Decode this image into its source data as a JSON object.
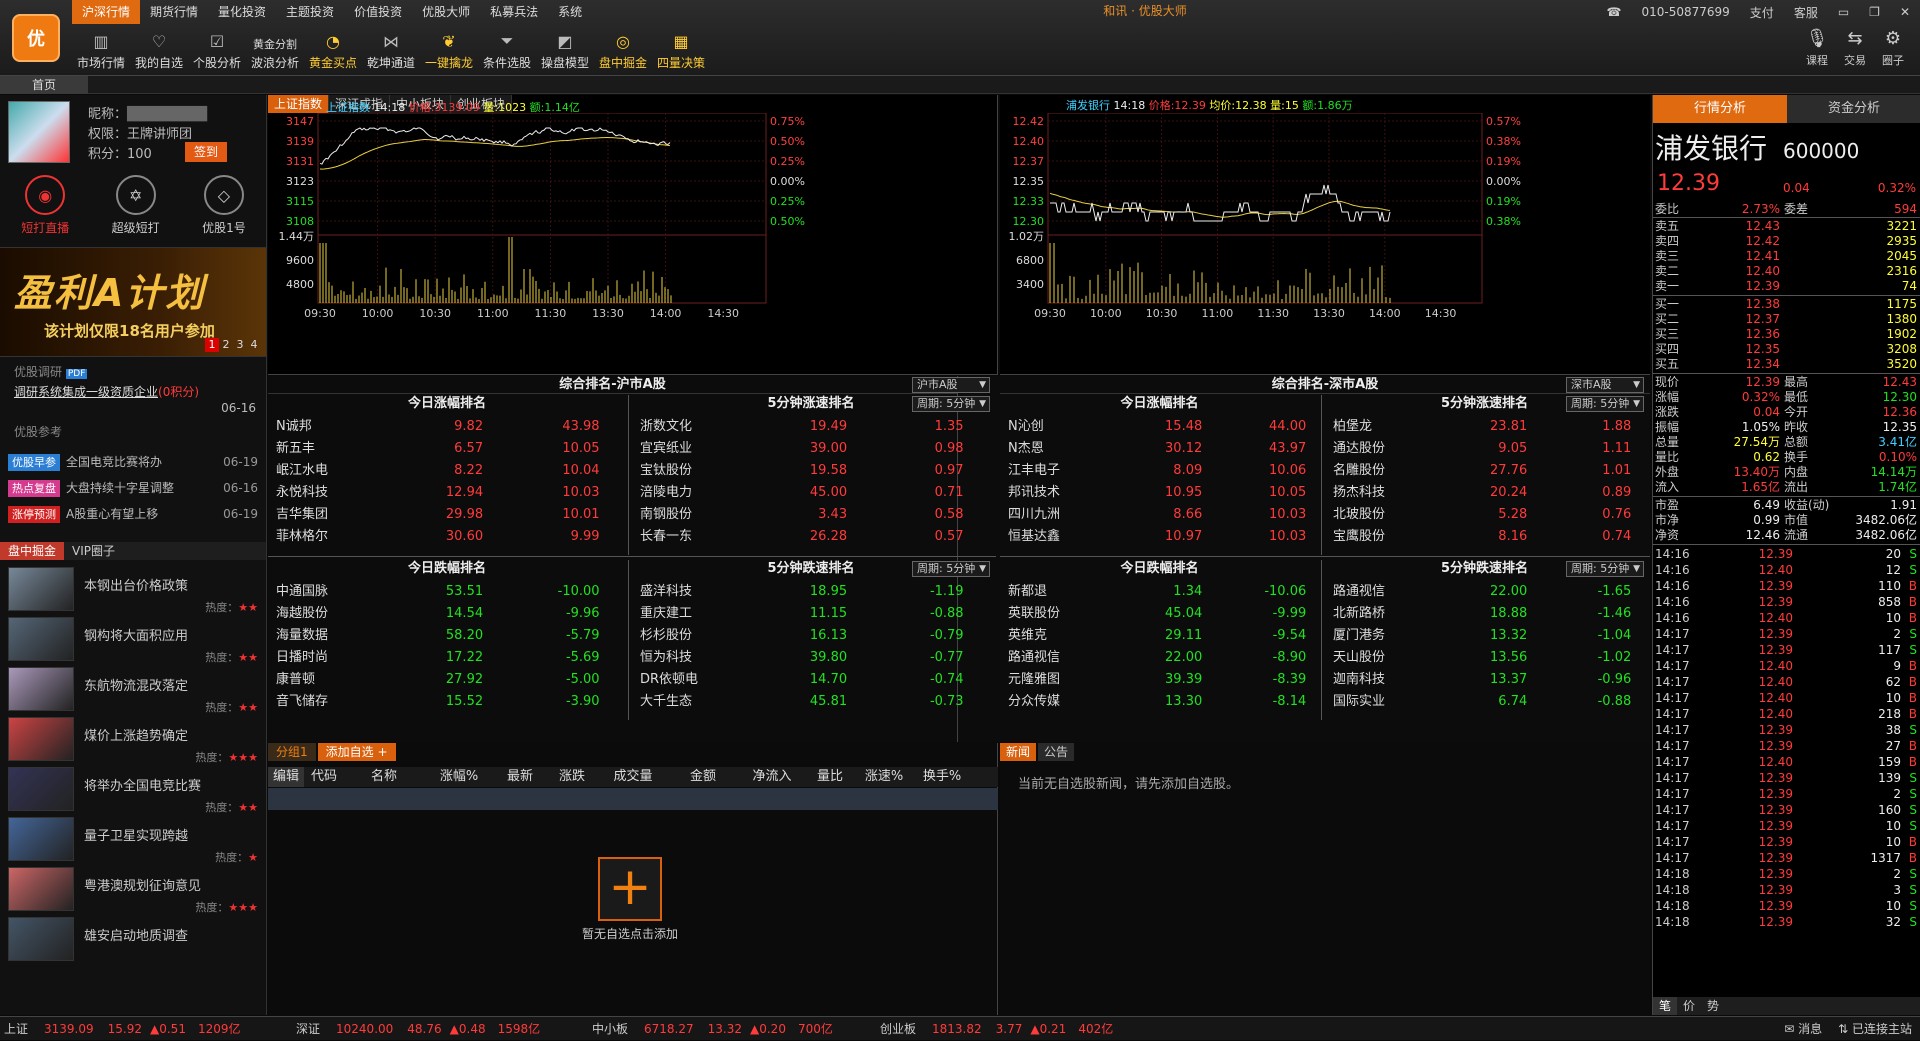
{
  "app": {
    "title": "和讯 · 优股大师",
    "phone": "010-50877699",
    "pay": "支付",
    "support": "客服"
  },
  "topmenu": [
    "沪深行情",
    "期货行情",
    "量化投资",
    "主题投资",
    "价值投资",
    "优股大师",
    "私募兵法",
    "系统"
  ],
  "toolbar": [
    {
      "label": "市场行情",
      "icon": "chart-icon"
    },
    {
      "label": "我的自选",
      "icon": "heart-icon"
    },
    {
      "label": "个股分析",
      "icon": "check-icon"
    },
    {
      "label": "波浪分析",
      "icon": "wave-icon",
      "top": "黄金分割"
    },
    {
      "label": "黄金买点",
      "icon": "radar-icon",
      "gold": true
    },
    {
      "label": "乾坤通道",
      "icon": "nodes-icon"
    },
    {
      "label": "一键擒龙",
      "icon": "dragon-icon",
      "gold": true
    },
    {
      "label": "条件选股",
      "icon": "funnel-icon"
    },
    {
      "label": "操盘模型",
      "icon": "model-icon"
    },
    {
      "label": "盘中掘金",
      "icon": "coin-icon",
      "gold": true
    },
    {
      "label": "四量决策",
      "icon": "abacus-icon",
      "gold": true
    }
  ],
  "rightbtns": [
    {
      "label": "课程",
      "icon": "mic-icon"
    },
    {
      "label": "交易",
      "icon": "trade-icon"
    },
    {
      "label": "圈子",
      "icon": "circle-icon"
    }
  ],
  "hometab": "首页",
  "user": {
    "nick_label": "昵称：",
    "nick": "████████",
    "rights_label": "权限：",
    "rights": "王牌讲师团",
    "points_label": "积分：",
    "points": "100",
    "sign": "签到"
  },
  "sideicons": [
    {
      "label": "短打直播",
      "icon": "live-icon",
      "active": true
    },
    {
      "label": "超级短打",
      "icon": "star-icon"
    },
    {
      "label": "优股1号",
      "icon": "gem-icon"
    }
  ],
  "banner": {
    "big": "盈利A计划",
    "small": "该计划仅限18名用户参加",
    "pages": [
      "1",
      "2",
      "3",
      "4"
    ]
  },
  "research": {
    "head": "优股调研",
    "badge": "PDF",
    "item": "调研系统集成一级资质企业",
    "points": "(0积分)",
    "date": "06-16"
  },
  "reference": {
    "head": "优股参考",
    "items": [
      {
        "tag": "优股早参",
        "color": "#2a7fd4",
        "text": "全国电竞比赛将办",
        "date": "06-19"
      },
      {
        "tag": "热点复盘",
        "color": "#d43b8f",
        "text": "大盘持续十字星调整",
        "date": "06-16"
      },
      {
        "tag": "涨停预测",
        "color": "#d02020",
        "text": "A股重心有望上移",
        "date": "06-19"
      }
    ]
  },
  "sidetabs": [
    "盘中掘金",
    "VIP圈子"
  ],
  "feed": {
    "heat_label": "热度：",
    "items": [
      {
        "title": "本钢出台价格政策",
        "stars": "★★",
        "c": "#789"
      },
      {
        "title": "钢构将大面积应用",
        "stars": "★★",
        "c": "#567"
      },
      {
        "title": "东航物流混改落定",
        "stars": "★★",
        "c": "#a9b"
      },
      {
        "title": "煤价上涨趋势确定",
        "stars": "★★★",
        "c": "#c44"
      },
      {
        "title": "将举办全国电竞比赛",
        "stars": "★★",
        "c": "#335"
      },
      {
        "title": "量子卫星实现跨越",
        "stars": "★",
        "c": "#469"
      },
      {
        "title": "粤港澳规划征询意见",
        "stars": "★★★",
        "c": "#c66"
      },
      {
        "title": "雄安启动地质调查",
        "stars": "",
        "c": "#456"
      }
    ]
  },
  "idxtabs": [
    "上证指数",
    "深证成指",
    "中小板块",
    "创业板块"
  ],
  "chartL": {
    "name": "上证指数",
    "time": "14:18",
    "price_label": "价格:",
    "price": "3139.09",
    "vol_label": "量:",
    "vol": "1023",
    "amt_label": "额:",
    "amt": "1.14亿",
    "y_labels": [
      "3147",
      "3139",
      "3131",
      "3123",
      "3115",
      "3108"
    ],
    "pct_labels": [
      "0.75%",
      "0.50%",
      "0.25%",
      "0.00%",
      "0.25%",
      "0.50%"
    ],
    "vol_labels": [
      "1.44万",
      "9600",
      "4800"
    ],
    "x_labels": [
      "09:30",
      "10:00",
      "10:30",
      "11:00",
      "11:30",
      "13:30",
      "14:00",
      "14:30"
    ]
  },
  "chartR": {
    "name": "浦发银行",
    "time": "14:18",
    "price_label": "价格:",
    "price": "12.39",
    "avg_label": "均价:",
    "avg": "12.38",
    "vol_label": "量:",
    "vol": "15",
    "amt_label": "额:",
    "amt": "1.86万",
    "y_labels": [
      "12.42",
      "12.40",
      "12.37",
      "12.35",
      "12.33",
      "12.30"
    ],
    "pct_labels": [
      "0.57%",
      "0.38%",
      "0.19%",
      "0.00%",
      "0.19%",
      "0.38%"
    ],
    "vol_labels": [
      "1.02万",
      "6800",
      "3400"
    ],
    "x_labels": [
      "09:30",
      "10:00",
      "10:30",
      "11:00",
      "11:30",
      "13:30",
      "14:00",
      "14:30"
    ]
  },
  "rankL": {
    "title": "综合排名-沪市A股",
    "select": "沪市A股",
    "period": "周期: 5分钟",
    "up_title": "今日涨幅排名",
    "fast_up_title": "5分钟涨速排名",
    "down_title": "今日跌幅排名",
    "fast_down_title": "5分钟跌速排名",
    "up": [
      [
        "N诚邦",
        "9.82",
        "43.98"
      ],
      [
        "新五丰",
        "6.57",
        "10.05"
      ],
      [
        "岷江水电",
        "8.22",
        "10.04"
      ],
      [
        "永悦科技",
        "12.94",
        "10.03"
      ],
      [
        "吉华集团",
        "29.98",
        "10.01"
      ],
      [
        "菲林格尔",
        "30.60",
        "9.99"
      ]
    ],
    "fast_up": [
      [
        "浙数文化",
        "19.49",
        "1.35"
      ],
      [
        "宜宾纸业",
        "39.00",
        "0.98"
      ],
      [
        "宝钛股份",
        "19.58",
        "0.97"
      ],
      [
        "涪陵电力",
        "45.00",
        "0.71"
      ],
      [
        "南钢股份",
        "3.43",
        "0.58"
      ],
      [
        "长春一东",
        "26.28",
        "0.57"
      ]
    ],
    "down": [
      [
        "中通国脉",
        "53.51",
        "-10.00"
      ],
      [
        "海越股份",
        "14.54",
        "-9.96"
      ],
      [
        "海量数据",
        "58.20",
        "-5.79"
      ],
      [
        "日播时尚",
        "17.22",
        "-5.69"
      ],
      [
        "康普顿",
        "27.92",
        "-5.00"
      ],
      [
        "音飞储存",
        "15.52",
        "-3.90"
      ]
    ],
    "fast_down": [
      [
        "盛洋科技",
        "18.95",
        "-1.19"
      ],
      [
        "重庆建工",
        "11.15",
        "-0.88"
      ],
      [
        "杉杉股份",
        "16.13",
        "-0.79"
      ],
      [
        "恒为科技",
        "39.80",
        "-0.77"
      ],
      [
        "DR依顿电",
        "14.70",
        "-0.74"
      ],
      [
        "大千生态",
        "45.81",
        "-0.73"
      ]
    ]
  },
  "rankR": {
    "title": "综合排名-深市A股",
    "select": "深市A股",
    "period": "周期: 5分钟",
    "up_title": "今日涨幅排名",
    "fast_up_title": "5分钟涨速排名",
    "down_title": "今日跌幅排名",
    "fast_down_title": "5分钟跌速排名",
    "up": [
      [
        "N沁创",
        "15.48",
        "44.00"
      ],
      [
        "N杰恩",
        "30.12",
        "43.97"
      ],
      [
        "江丰电子",
        "8.09",
        "10.06"
      ],
      [
        "邦讯技术",
        "10.95",
        "10.05"
      ],
      [
        "四川九洲",
        "8.66",
        "10.03"
      ],
      [
        "恒基达鑫",
        "10.97",
        "10.03"
      ]
    ],
    "fast_up": [
      [
        "柏堡龙",
        "23.81",
        "1.88"
      ],
      [
        "通达股份",
        "9.05",
        "1.11"
      ],
      [
        "名雕股份",
        "27.76",
        "1.01"
      ],
      [
        "扬杰科技",
        "20.24",
        "0.89"
      ],
      [
        "北玻股份",
        "5.28",
        "0.76"
      ],
      [
        "宝鹰股份",
        "8.16",
        "0.74"
      ]
    ],
    "down": [
      [
        "新都退",
        "1.34",
        "-10.06"
      ],
      [
        "英联股份",
        "45.04",
        "-9.99"
      ],
      [
        "英维克",
        "29.11",
        "-9.54"
      ],
      [
        "路通视信",
        "22.00",
        "-8.90"
      ],
      [
        "元隆雅图",
        "39.39",
        "-8.39"
      ],
      [
        "分众传媒",
        "13.30",
        "-8.14"
      ]
    ],
    "fast_down": [
      [
        "路通视信",
        "22.00",
        "-1.65"
      ],
      [
        "北新路桥",
        "18.88",
        "-1.46"
      ],
      [
        "厦门港务",
        "13.32",
        "-1.04"
      ],
      [
        "天山股份",
        "13.56",
        "-1.02"
      ],
      [
        "迦南科技",
        "13.37",
        "-0.96"
      ],
      [
        "国际实业",
        "6.74",
        "-0.88"
      ]
    ]
  },
  "watch": {
    "tabs": [
      "分组1",
      "添加自选 +"
    ],
    "cols": [
      "编辑",
      "代码",
      "名称",
      "涨幅%",
      "最新",
      "涨跌",
      "成交量",
      "金额",
      "净流入",
      "量比",
      "涨速%",
      "换手%"
    ],
    "empty": "暂无自选点击添加",
    "plus": "+"
  },
  "news": {
    "tabs": [
      "新闻",
      "公告"
    ],
    "empty": "当前无自选股新闻，请先添加自选股。"
  },
  "quote": {
    "tabs": [
      "行情分析",
      "资金分析"
    ],
    "name": "浦发银行",
    "code": "600000",
    "price": "12.39",
    "chg": "0.04",
    "pct": "0.32%",
    "weibi": [
      "委比",
      "2.73%",
      "委差",
      "594"
    ],
    "asks": [
      [
        "卖五",
        "12.43",
        "3221"
      ],
      [
        "卖四",
        "12.42",
        "2935"
      ],
      [
        "卖三",
        "12.41",
        "2045"
      ],
      [
        "卖二",
        "12.40",
        "2316"
      ],
      [
        "卖一",
        "12.39",
        "74"
      ]
    ],
    "bids": [
      [
        "买一",
        "12.38",
        "1175"
      ],
      [
        "买二",
        "12.37",
        "1380"
      ],
      [
        "买三",
        "12.36",
        "1902"
      ],
      [
        "买四",
        "12.35",
        "3208"
      ],
      [
        "买五",
        "12.34",
        "3520"
      ]
    ],
    "stats": [
      [
        "现价",
        "12.39",
        "最高",
        "12.43"
      ],
      [
        "涨幅",
        "0.32%",
        "最低",
        "12.30"
      ],
      [
        "涨跌",
        "0.04",
        "今开",
        "12.36"
      ],
      [
        "振幅",
        "1.05%",
        "昨收",
        "12.35"
      ],
      [
        "总量",
        "27.54万",
        "总额",
        "3.41亿"
      ],
      [
        "量比",
        "0.62",
        "换手",
        "0.10%"
      ],
      [
        "外盘",
        "13.40万",
        "内盘",
        "14.14万"
      ],
      [
        "流入",
        "1.65亿",
        "流出",
        "1.74亿"
      ]
    ],
    "fin": [
      [
        "市盈",
        "6.49",
        "收益(动)",
        "1.91"
      ],
      [
        "市净",
        "0.99",
        "市值",
        "3482.06亿"
      ],
      [
        "净资",
        "12.46",
        "流通",
        "3482.06亿"
      ]
    ],
    "ticks": [
      [
        "14:16",
        "12.39",
        "20",
        "S"
      ],
      [
        "14:16",
        "12.40",
        "12",
        "S"
      ],
      [
        "14:16",
        "12.39",
        "110",
        "B"
      ],
      [
        "14:16",
        "12.39",
        "858",
        "B"
      ],
      [
        "14:16",
        "12.40",
        "10",
        "B"
      ],
      [
        "14:17",
        "12.39",
        "2",
        "S"
      ],
      [
        "14:17",
        "12.39",
        "117",
        "S"
      ],
      [
        "14:17",
        "12.40",
        "9",
        "B"
      ],
      [
        "14:17",
        "12.40",
        "62",
        "B"
      ],
      [
        "14:17",
        "12.40",
        "10",
        "B"
      ],
      [
        "14:17",
        "12.40",
        "218",
        "B"
      ],
      [
        "14:17",
        "12.39",
        "38",
        "S"
      ],
      [
        "14:17",
        "12.39",
        "27",
        "B"
      ],
      [
        "14:17",
        "12.40",
        "159",
        "B"
      ],
      [
        "14:17",
        "12.39",
        "139",
        "S"
      ],
      [
        "14:17",
        "12.39",
        "2",
        "S"
      ],
      [
        "14:17",
        "12.39",
        "160",
        "S"
      ],
      [
        "14:17",
        "12.39",
        "10",
        "S"
      ],
      [
        "14:17",
        "12.39",
        "10",
        "B"
      ],
      [
        "14:17",
        "12.39",
        "1317",
        "B"
      ],
      [
        "14:18",
        "12.39",
        "2",
        "S"
      ],
      [
        "14:18",
        "12.39",
        "3",
        "S"
      ],
      [
        "14:18",
        "12.39",
        "10",
        "S"
      ],
      [
        "14:18",
        "12.39",
        "32",
        "S"
      ]
    ],
    "bottabs": [
      "笔",
      "价",
      "势"
    ]
  },
  "status": {
    "sh": [
      "上证",
      "3139.09",
      "15.92",
      "0.51",
      "1209亿"
    ],
    "sz": [
      "深证",
      "10240.00",
      "48.76",
      "0.48",
      "1598亿"
    ],
    "zx": [
      "中小板",
      "6718.27",
      "13.32",
      "0.20",
      "700亿"
    ],
    "cy": [
      "创业板",
      "1813.82",
      "3.77",
      "0.21",
      "402亿"
    ],
    "msg": "消息",
    "conn": "已连接主站"
  }
}
